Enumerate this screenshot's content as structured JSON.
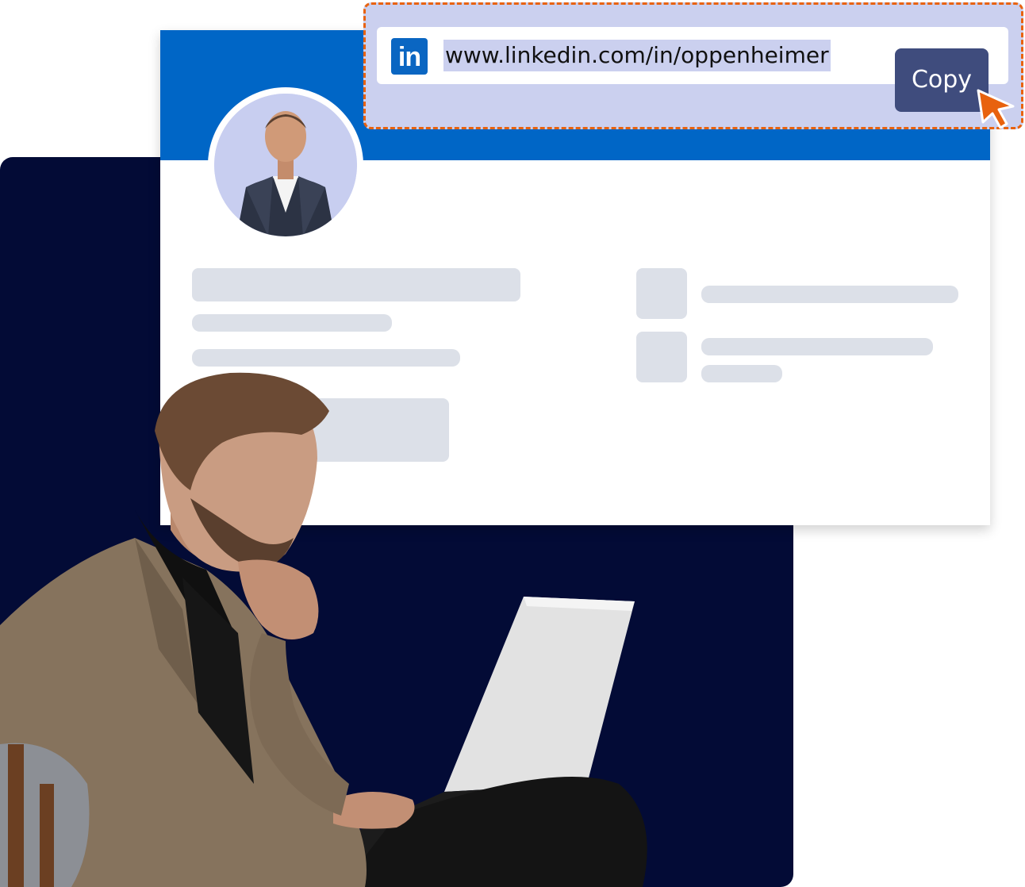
{
  "url_bar": {
    "logo_text": "in",
    "url": "www.linkedin.com/in/oppenheimer",
    "copy_label": "Copy"
  },
  "colors": {
    "banner": "#0066c6",
    "navy_panel": "#030b36",
    "url_box_bg": "#cbd0ef",
    "dashed_border": "#e8620e",
    "copy_button": "#3f4c7d",
    "linkedin_blue": "#0a66c2",
    "placeholder": "#dce0e8"
  },
  "icons": {
    "logo": "linkedin-logo-icon",
    "cursor": "mouse-pointer-icon"
  }
}
